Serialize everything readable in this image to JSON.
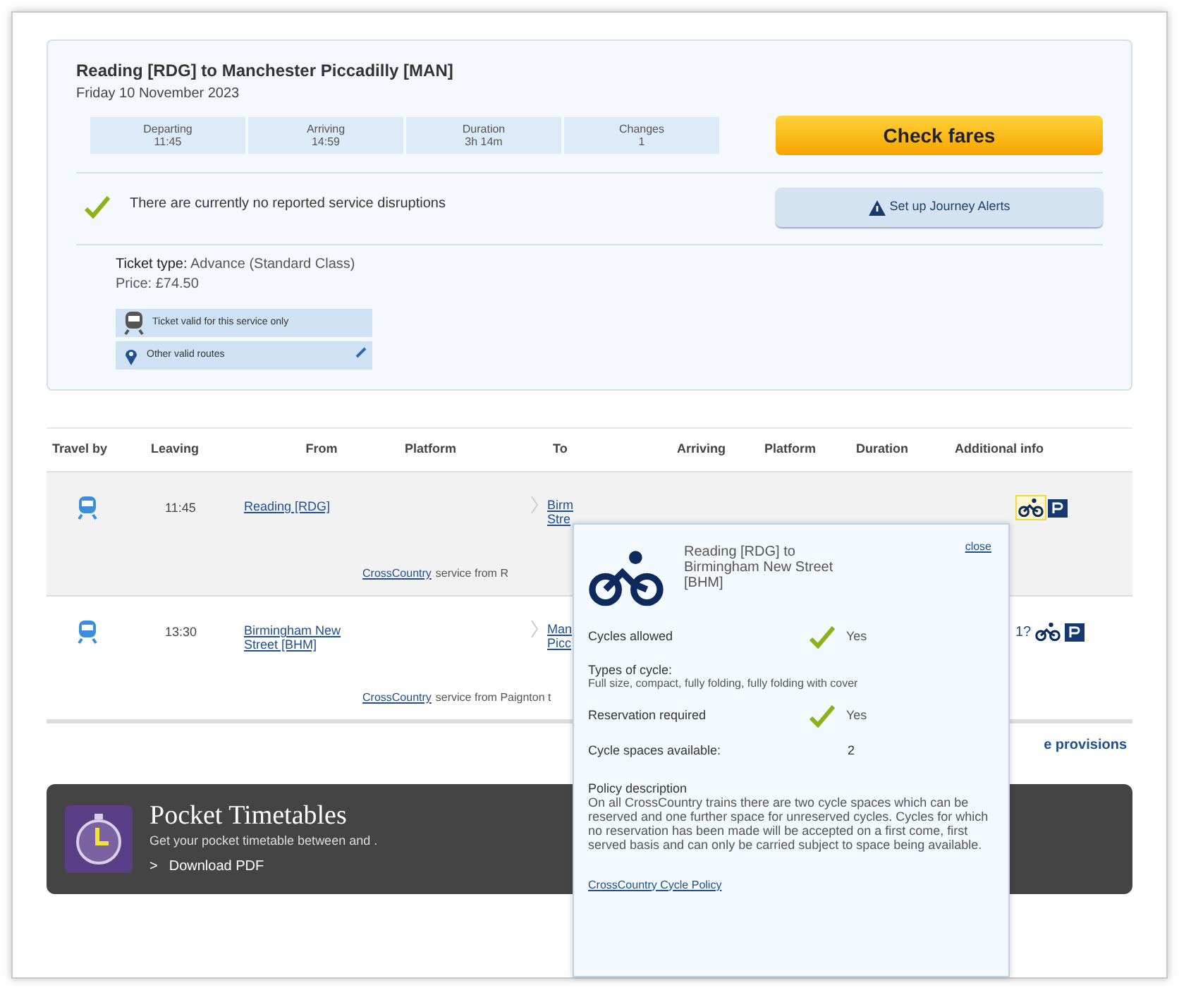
{
  "journey": {
    "title": "Reading [RDG] to Manchester Piccadilly [MAN]",
    "date": "Friday 10 November 2023",
    "summary": [
      {
        "label": "Departing",
        "value": "11:45"
      },
      {
        "label": "Arriving",
        "value": "14:59"
      },
      {
        "label": "Duration",
        "value": "3h 14m"
      },
      {
        "label": "Changes",
        "value": "1"
      }
    ],
    "check_fares": "Check fares",
    "disruptions": "There are currently no reported service disruptions",
    "alerts_button": "Set up Journey Alerts",
    "ticket_type_label": "Ticket type:",
    "ticket_type": "Advance (Standard Class)",
    "price": "Price: £74.50",
    "ticket_links": [
      {
        "kind": "train",
        "label": "Ticket valid for this service only"
      },
      {
        "kind": "pin",
        "label": "Other valid routes"
      }
    ]
  },
  "table": {
    "columns": [
      "Travel by",
      "Leaving",
      "From",
      "Platform",
      "To",
      "Arriving",
      "Platform",
      "Duration",
      "Additional info"
    ],
    "rows": [
      {
        "leaving": "11:45",
        "from": "Reading [RDG]",
        "to": "Birm Stre",
        "operator": "CrossCountry",
        "service": "service from R",
        "shaded": true,
        "info_selected": true,
        "partial": ""
      },
      {
        "leaving": "13:30",
        "from": "Birmingham New Street [BHM]",
        "to": "Man Picc",
        "operator": "CrossCountry",
        "service": "service from Paignton t",
        "shaded": false,
        "info_selected": false,
        "partial": "1?"
      }
    ],
    "footer_link": "e provisions"
  },
  "popup": {
    "close": "close",
    "title": "Reading [RDG] to Birmingham New Street [BHM]",
    "cycles_allowed_label": "Cycles allowed",
    "cycles_allowed": "Yes",
    "types_label": "Types of cycle:",
    "types": "Full size, compact, fully folding, fully folding with cover",
    "reservation_label": "Reservation required",
    "reservation": "Yes",
    "spaces_label": "Cycle spaces available:",
    "spaces": "2",
    "policy_label": "Policy description",
    "policy": "On all CrossCountry trains there are two cycle spaces which can be reserved and one further space for unreserved cycles. Cycles for which no reservation has been made will be accepted on a first come, first served basis and can only be carried subject to space being available.",
    "policy_link": "CrossCountry Cycle Policy"
  },
  "banner": {
    "title": "Pocket Timetables",
    "text": "Get your pocket timetable between and .",
    "link_marker": ">",
    "link": "Download PDF"
  }
}
